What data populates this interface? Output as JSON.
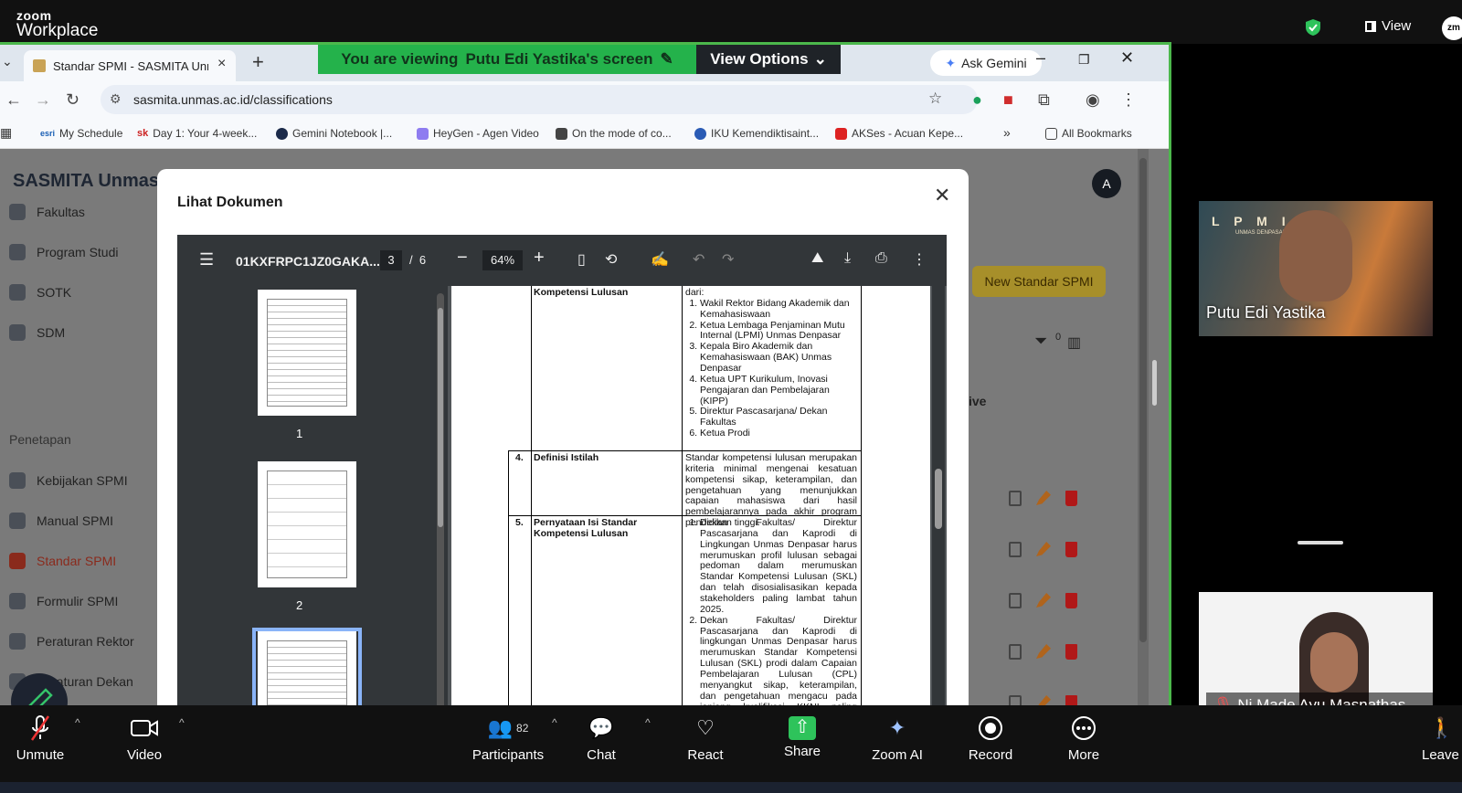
{
  "zoom": {
    "logo_line1": "zoom",
    "logo_line2": "Workplace",
    "view_label": "View",
    "avatar_initials": "zm",
    "share_banner_prefix": "You are viewing",
    "share_banner_name": "Putu Edi Yastika's screen",
    "view_options_label": "View Options",
    "participants": [
      {
        "name": "Putu Edi Yastika",
        "tile_logo": "L P M I",
        "tile_logo_sub": "UNMAS DENPASAR"
      },
      {
        "name": "Ni Made Ayu Masnathas..."
      }
    ],
    "toolbar": {
      "unmute": "Unmute",
      "video": "Video",
      "participants": "Participants",
      "participants_count": "82",
      "chat": "Chat",
      "react": "React",
      "share": "Share",
      "zoom_ai": "Zoom AI",
      "record": "Record",
      "more": "More",
      "leave": "Leave"
    },
    "accent_green": "#24b24b"
  },
  "browser": {
    "tab_title": "Standar SPMI - SASMITA Unmas",
    "url": "sasmita.unmas.ac.id/classifications",
    "ask_gemini": "Ask Gemini",
    "bookmarks": [
      {
        "label": "My Schedule",
        "icon": "esri"
      },
      {
        "label": "Day 1: Your 4-week...",
        "icon": "sk"
      },
      {
        "label": "Gemini Notebook |...",
        "icon": ""
      },
      {
        "label": "HeyGen - Agen Video",
        "icon": ""
      },
      {
        "label": "On the mode of co...",
        "icon": ""
      },
      {
        "label": "IKU Kemendiktisaint...",
        "icon": ""
      },
      {
        "label": "AKSes - Acuan Kepe...",
        "icon": ""
      }
    ],
    "all_bookmarks": "All Bookmarks"
  },
  "app": {
    "brand": "SASMITA Unmas",
    "sidebar_items": [
      {
        "label": "Fakultas"
      },
      {
        "label": "Program Studi"
      },
      {
        "label": "SOTK"
      },
      {
        "label": "SDM"
      }
    ],
    "section_label": "Penetapan",
    "section_items": [
      {
        "label": "Kebijakan SPMI"
      },
      {
        "label": "Manual SPMI"
      },
      {
        "label": "Standar SPMI"
      },
      {
        "label": "Formulir SPMI"
      },
      {
        "label": "Peraturan Rektor"
      },
      {
        "label": "Peraturan Dekan"
      },
      {
        "label": "oman"
      },
      {
        "label": "OP"
      }
    ],
    "avatar": "A",
    "new_button": "New Standar SPMI",
    "column_fragment": "ive",
    "filter_count": "0"
  },
  "modal": {
    "title": "Lihat Dokumen",
    "pdf": {
      "file_name": "01KXFRPC1JZ0GAKA...",
      "current_page": "3",
      "total_pages": "6",
      "zoom": "64%",
      "thumbnail_labels": [
        "1",
        "2"
      ]
    },
    "document": {
      "row3_label": "Kompetensi Lulusan",
      "row3_intro": "dari:",
      "row3_items": [
        "Wakil Rektor Bidang Akademik dan Kemahasiswaan",
        "Ketua Lembaga Penjaminan Mutu Internal (LPMI) Unmas Denpasar",
        "Kepala Biro Akademik dan Kemahasiswaan (BAK) Unmas Denpasar",
        "Ketua UPT Kurikulum, Inovasi Pengajaran dan Pembelajaran (KIPP)",
        "Direktur Pascasarjana/ Dekan Fakultas",
        "Ketua Prodi"
      ],
      "row4_num": "4.",
      "row4_label": "Definisi Istilah",
      "row4_text": "Standar kompetensi lulusan merupakan kriteria minimal mengenai kesatuan kompetensi sikap, keterampilan, dan pengetahuan yang menunjukkan capaian mahasiswa dari hasil pembelajarannya pada akhir program pendidikan tinggi.",
      "row5_num": "5.",
      "row5_label": "Pernyataan Isi Standar Kompetensi Lulusan",
      "row5_items": [
        "Dekan Fakultas/ Direktur Pascasarjana dan Kaprodi di Lingkungan Unmas Denpasar harus merumuskan profil lulusan sebagai pedoman dalam merumuskan Standar Kompetensi Lulusan (SKL) dan telah disosialisasikan kepada stakeholders paling lambat tahun 2025.",
        "Dekan Fakultas/ Direktur Pascasarjana dan Kaprodi di lingkungan Unmas Denpasar harus merumuskan Standar Kompetensi Lulusan (SKL) prodi dalam Capaian Pembelajaran Lulusan (CPL) menyangkut sikap, keterampilan, dan pengetahuan mengacu pada jenjang kualifikasi KKNI paling lambat tahun 2025."
      ]
    }
  }
}
